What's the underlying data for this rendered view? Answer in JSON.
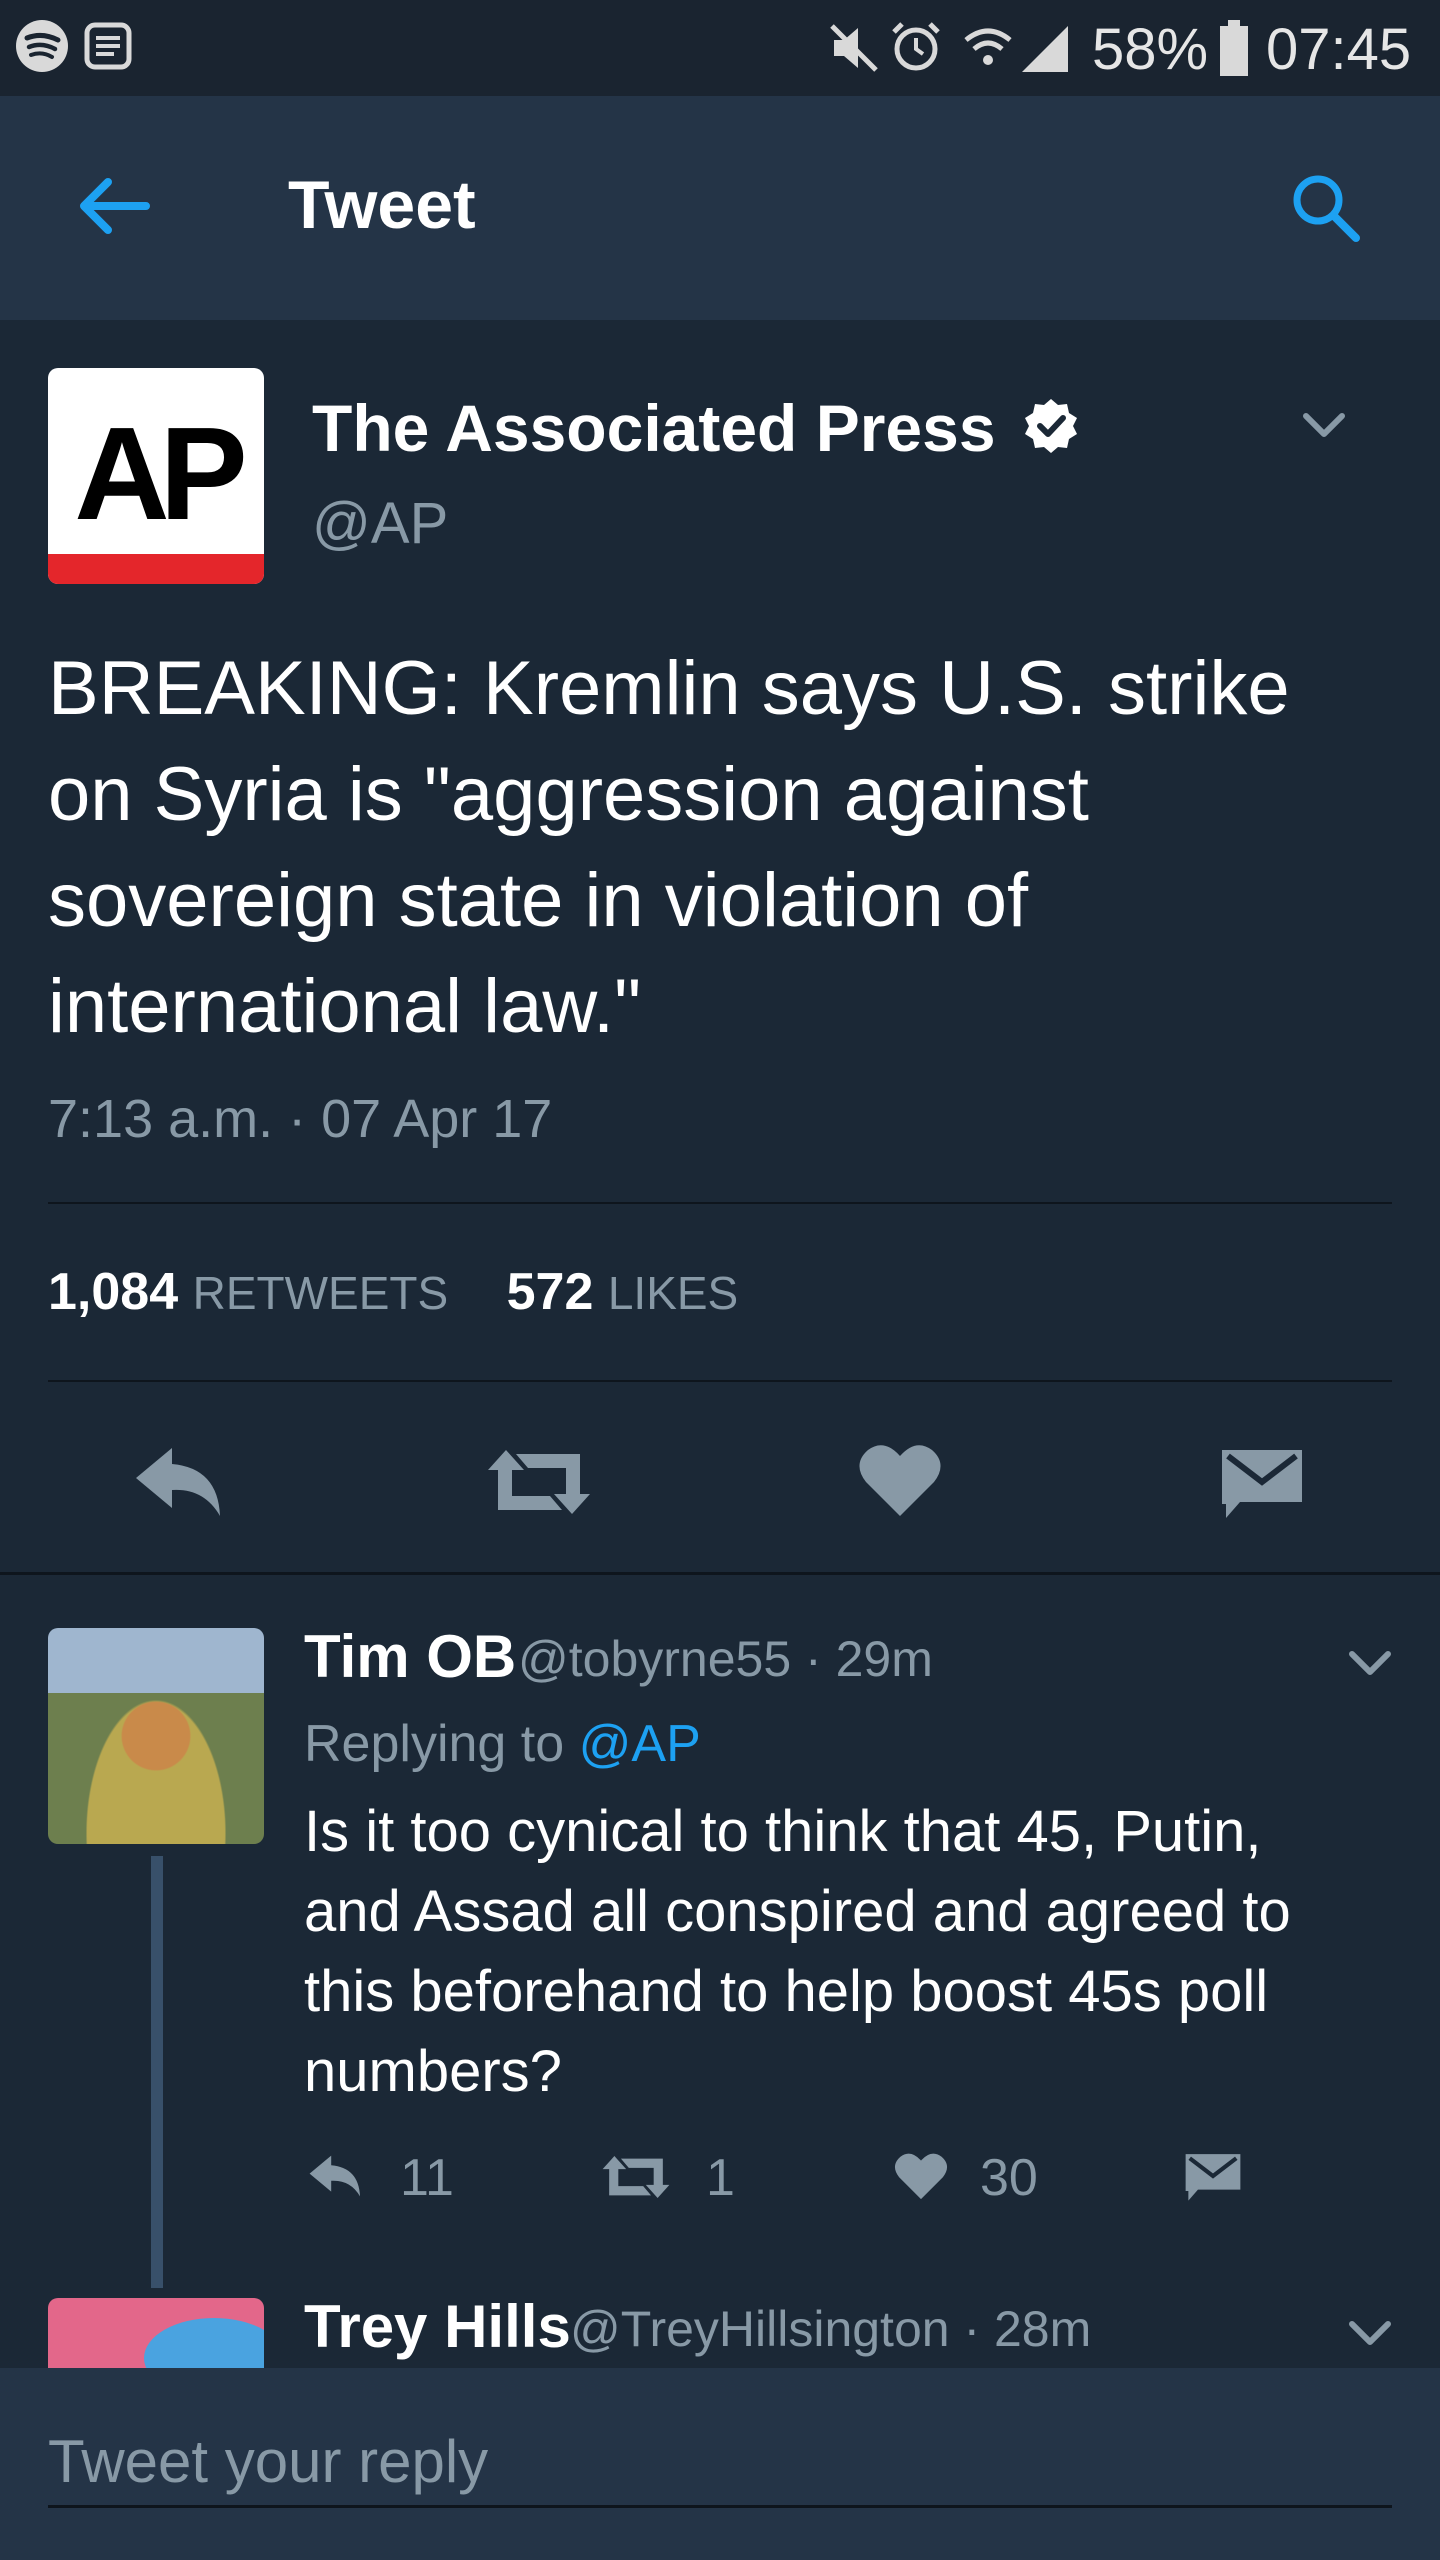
{
  "status_bar": {
    "battery": "58%",
    "time": "07:45"
  },
  "header": {
    "title": "Tweet"
  },
  "tweet": {
    "avatar_text": "AP",
    "author_name": "The Associated Press",
    "author_handle": "@AP",
    "text": "BREAKING: Kremlin says U.S. strike on Syria is \"aggression against sovereign state in violation of international law.\"",
    "timestamp": "7:13 a.m. · 07 Apr 17",
    "retweets_count": "1,084",
    "retweets_label": "RETWEETS",
    "likes_count": "572",
    "likes_label": "LIKES"
  },
  "reply": {
    "name": "Tim OB",
    "meta": "@tobyrne55 · 29m",
    "replying_prefix": "Replying to",
    "replying_handle": "@AP",
    "text": "Is it too cynical to think that 45, Putin, and Assad all conspired and agreed to this beforehand to help boost 45s poll numbers?",
    "reply_count": "11",
    "retweet_count": "1",
    "like_count": "30"
  },
  "next_reply": {
    "name": "Trey Hills",
    "meta": "@TreyHillsington · 28m"
  },
  "composer": {
    "placeholder": "Tweet your reply"
  },
  "colors": {
    "background": "#1b2836",
    "header": "#243447",
    "accent": "#1da1f2",
    "muted": "#8899a6",
    "icon": "#8899a6"
  },
  "icons": [
    "spotify-icon",
    "notes-icon",
    "mute-icon",
    "alarm-icon",
    "wifi-icon",
    "signal-icon",
    "battery-icon",
    "back-arrow-icon",
    "search-icon",
    "verified-badge-icon",
    "chevron-down-icon",
    "reply-icon",
    "retweet-icon",
    "heart-icon",
    "dm-icon"
  ]
}
